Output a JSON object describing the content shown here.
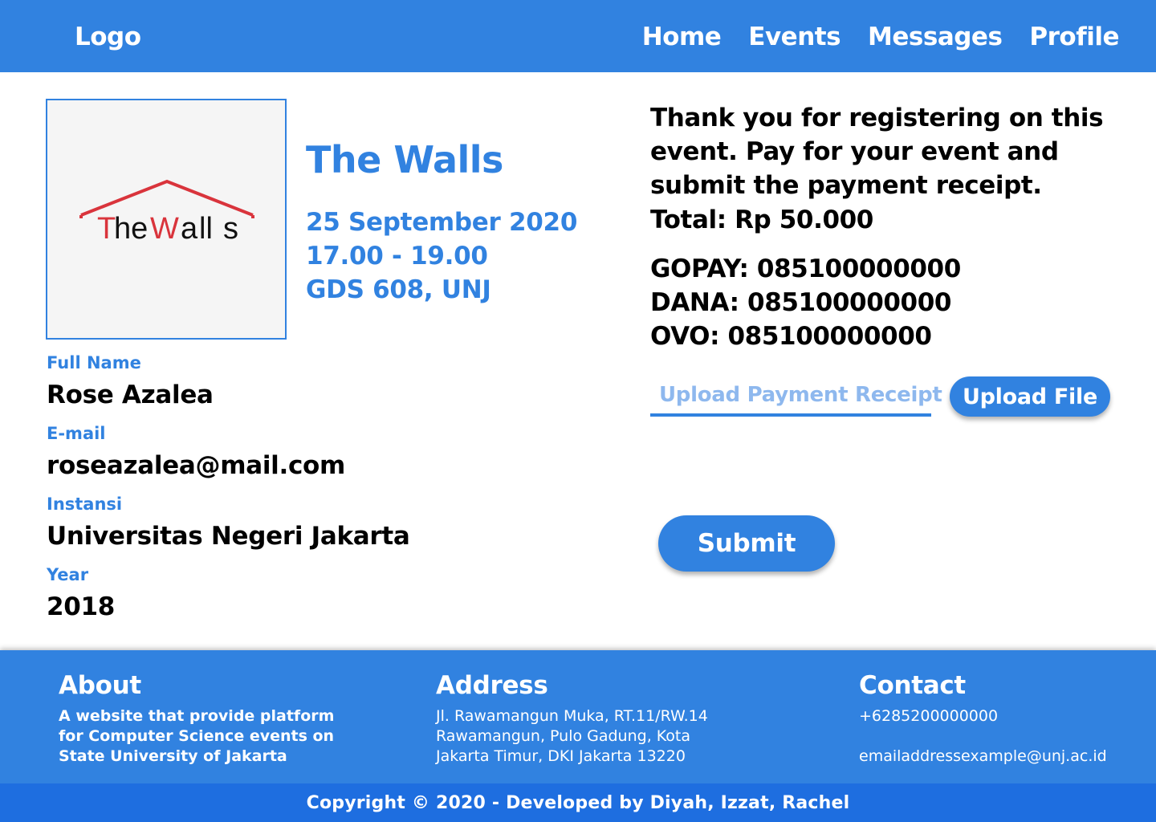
{
  "nav": {
    "logo": "Logo",
    "links": [
      "Home",
      "Events",
      "Messages",
      "Profile"
    ]
  },
  "event": {
    "image_logo_text": {
      "prefix": "T",
      "middle": "he",
      "w": "W",
      "end": "a",
      "ll": "ll",
      "s": "s"
    },
    "title": "The Walls",
    "date": "25 September 2020",
    "time": "17.00 - 19.00",
    "location": "GDS 608, UNJ"
  },
  "registrant": {
    "fields": [
      {
        "label": "Full Name",
        "value": "Rose Azalea"
      },
      {
        "label": "E-mail",
        "value": "roseazalea@mail.com"
      },
      {
        "label": "Instansi",
        "value": "Universitas Negeri Jakarta"
      },
      {
        "label": "Year",
        "value": "2018"
      }
    ]
  },
  "payment": {
    "message": "Thank you for registering on this event. Pay for your event and submit the payment receipt.",
    "total": "Total: Rp 50.000",
    "methods": [
      "GOPAY: 085100000000",
      "DANA: 085100000000",
      "OVO: 085100000000"
    ],
    "upload_placeholder": "Upload Payment Receipt",
    "upload_button": "Upload File",
    "submit_button": "Submit"
  },
  "footer": {
    "about": {
      "heading": "About",
      "text": "A website that provide platform\nfor Computer Science events on\nState University of Jakarta"
    },
    "address": {
      "heading": "Address",
      "text": "Jl. Rawamangun Muka, RT.11/RW.14\nRawamangun, Pulo Gadung, Kota\nJakarta Timur, DKI Jakarta 13220"
    },
    "contact": {
      "heading": "Contact",
      "phone": "+6285200000000",
      "email": "emailaddressexample@unj.ac.id"
    },
    "copyright": "Copyright © 2020 - Developed by Diyah, Izzat, Rachel"
  },
  "colors": {
    "primary": "#3182e0",
    "copyright_bar": "#1e6ee0",
    "placeholder": "#8eb8ee",
    "logo_red": "#d9343c"
  }
}
